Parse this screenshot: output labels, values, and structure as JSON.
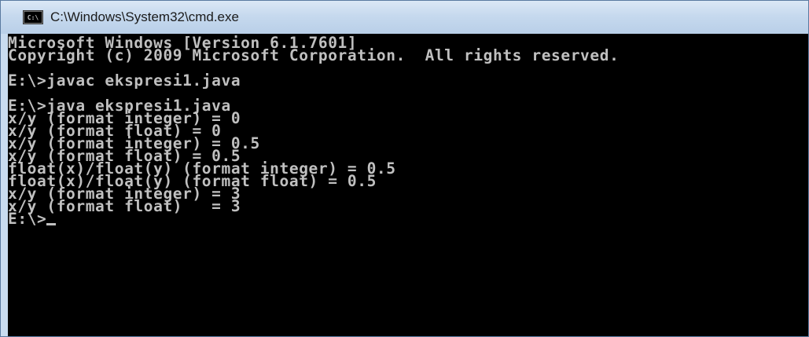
{
  "window": {
    "title": "C:\\Windows\\System32\\cmd.exe",
    "icon_text": "C:\\"
  },
  "console": {
    "lines": [
      "Microsoft Windows [Version 6.1.7601]",
      "Copyright (c) 2009 Microsoft Corporation.  All rights reserved.",
      "",
      "E:\\>javac ekspresi1.java",
      "",
      "E:\\>java ekspresi1.java",
      "x/y (format integer) = 0",
      "x/y (format float) = 0",
      "x/y (format integer) = 0.5",
      "x/y (format float) = 0.5",
      "float(x)/float(y) (format integer) = 0.5",
      "float(x)/float(y) (format float) = 0.5",
      "x/y (format integer) = 3",
      "x/y (format float)   = 3",
      "E:\\>"
    ]
  },
  "colors": {
    "console_bg": "#000000",
    "console_fg": "#c0c0c0",
    "titlebar": "#c6d9ee"
  }
}
